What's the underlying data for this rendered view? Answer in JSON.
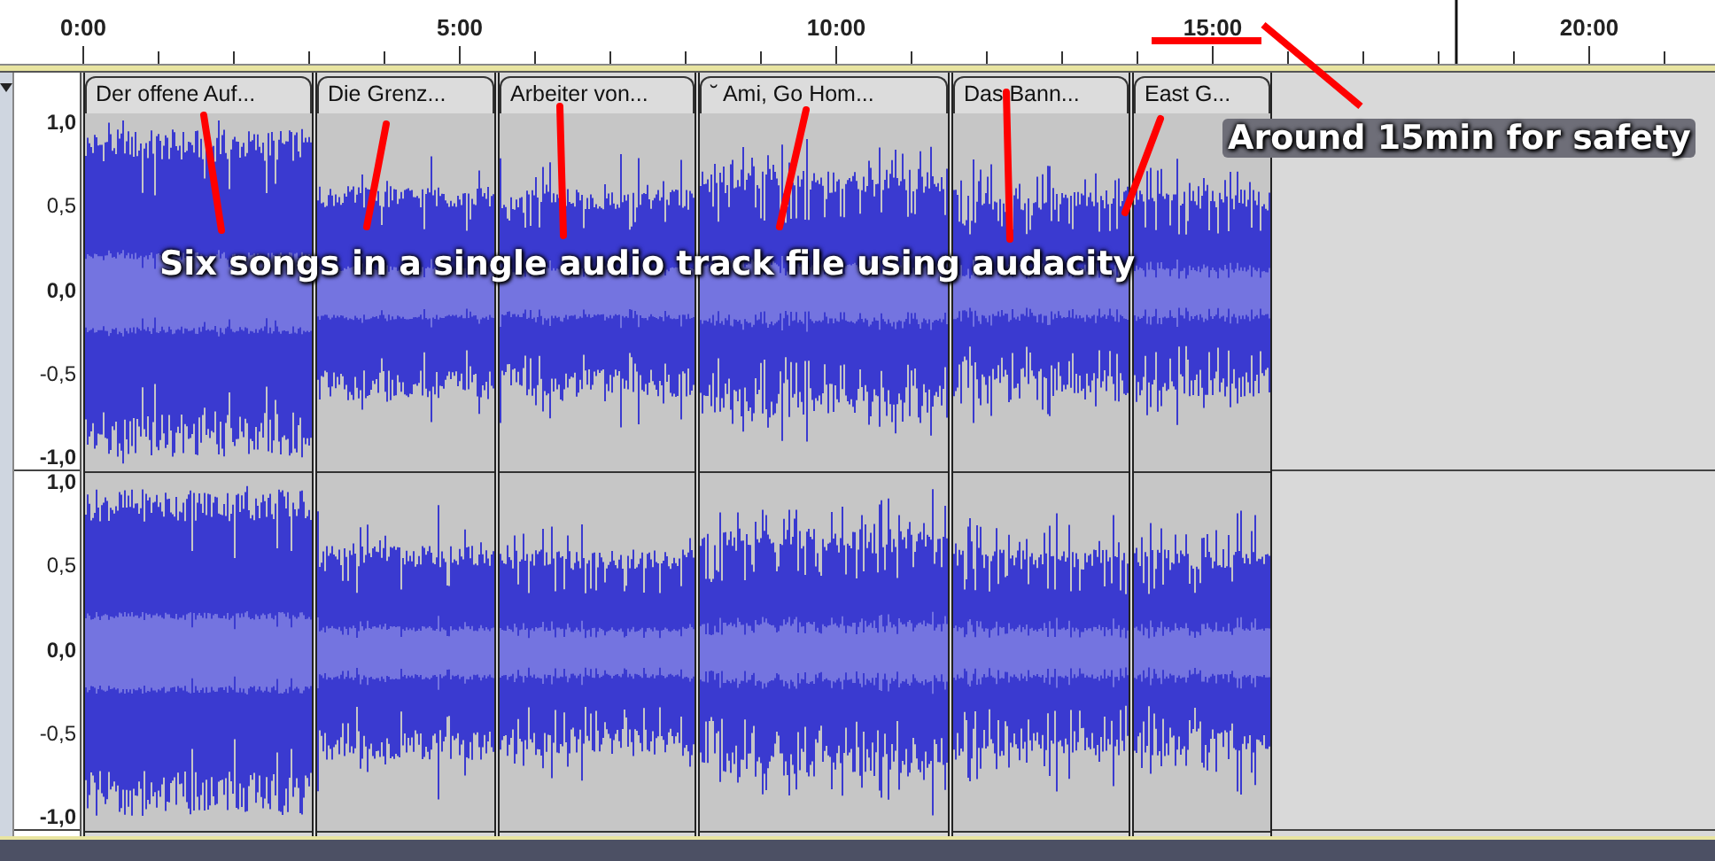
{
  "ruler": {
    "labels": [
      "0:00",
      "5:00",
      "10:00",
      "15:00",
      "20:00"
    ]
  },
  "track": {
    "channels": [
      {
        "scale": [
          "1,0",
          "0,5",
          "0,0",
          "-0,5",
          "-1,0"
        ]
      },
      {
        "scale": [
          "1,0",
          "0,5",
          "0,0",
          "-0,5",
          "-1,0"
        ]
      }
    ],
    "clips": [
      {
        "title": "Der offene Auf..."
      },
      {
        "title": "Die Grenz..."
      },
      {
        "title": "Arbeiter von..."
      },
      {
        "title": "˘ Ami, Go Hom..."
      },
      {
        "title": "Das Bann..."
      },
      {
        "title": "East G..."
      }
    ]
  },
  "annotations": [
    {
      "kind": "songs",
      "text": "Six songs in a single audio track file using audacity"
    },
    {
      "kind": "length",
      "text": "Around 15min for safety"
    }
  ]
}
